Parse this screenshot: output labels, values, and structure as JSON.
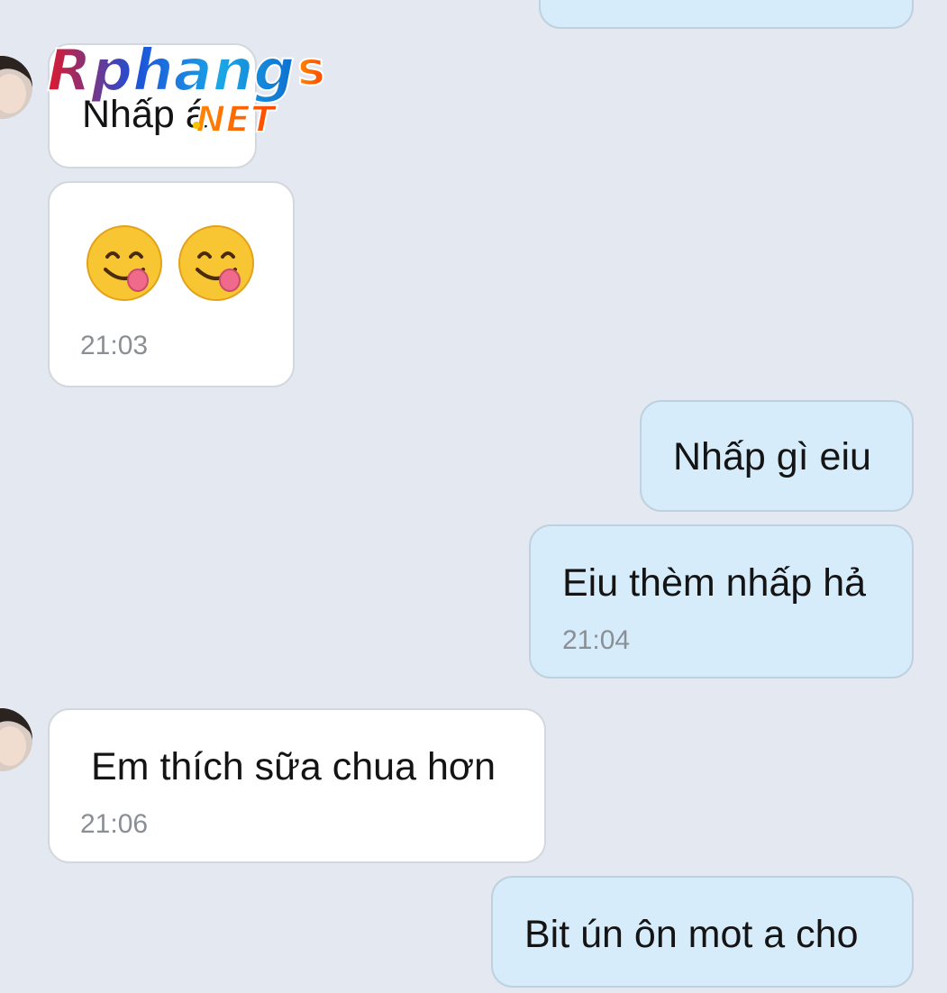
{
  "watermark": {
    "brand": "Rphangs",
    "suffix": "NET"
  },
  "messages": [
    {
      "direction": "out",
      "text": ""
    },
    {
      "direction": "in",
      "text": "Nhấp á"
    },
    {
      "direction": "in",
      "emoji": [
        "face-savoring-food",
        "face-savoring-food"
      ],
      "time": "21:03"
    },
    {
      "direction": "out",
      "text": "Nhấp gì eiu"
    },
    {
      "direction": "out",
      "text": "Eiu thèm nhấp hả",
      "time": "21:04"
    },
    {
      "direction": "in",
      "text": "Em thích sữa chua hơn",
      "time": "21:06"
    },
    {
      "direction": "out",
      "text": "Bit ún ôn mot a cho"
    }
  ],
  "colors": {
    "background": "#e3e8f1",
    "incoming_bubble": "#ffffff",
    "outgoing_bubble": "#d6ecfb",
    "timestamp": "#8a8f96"
  }
}
